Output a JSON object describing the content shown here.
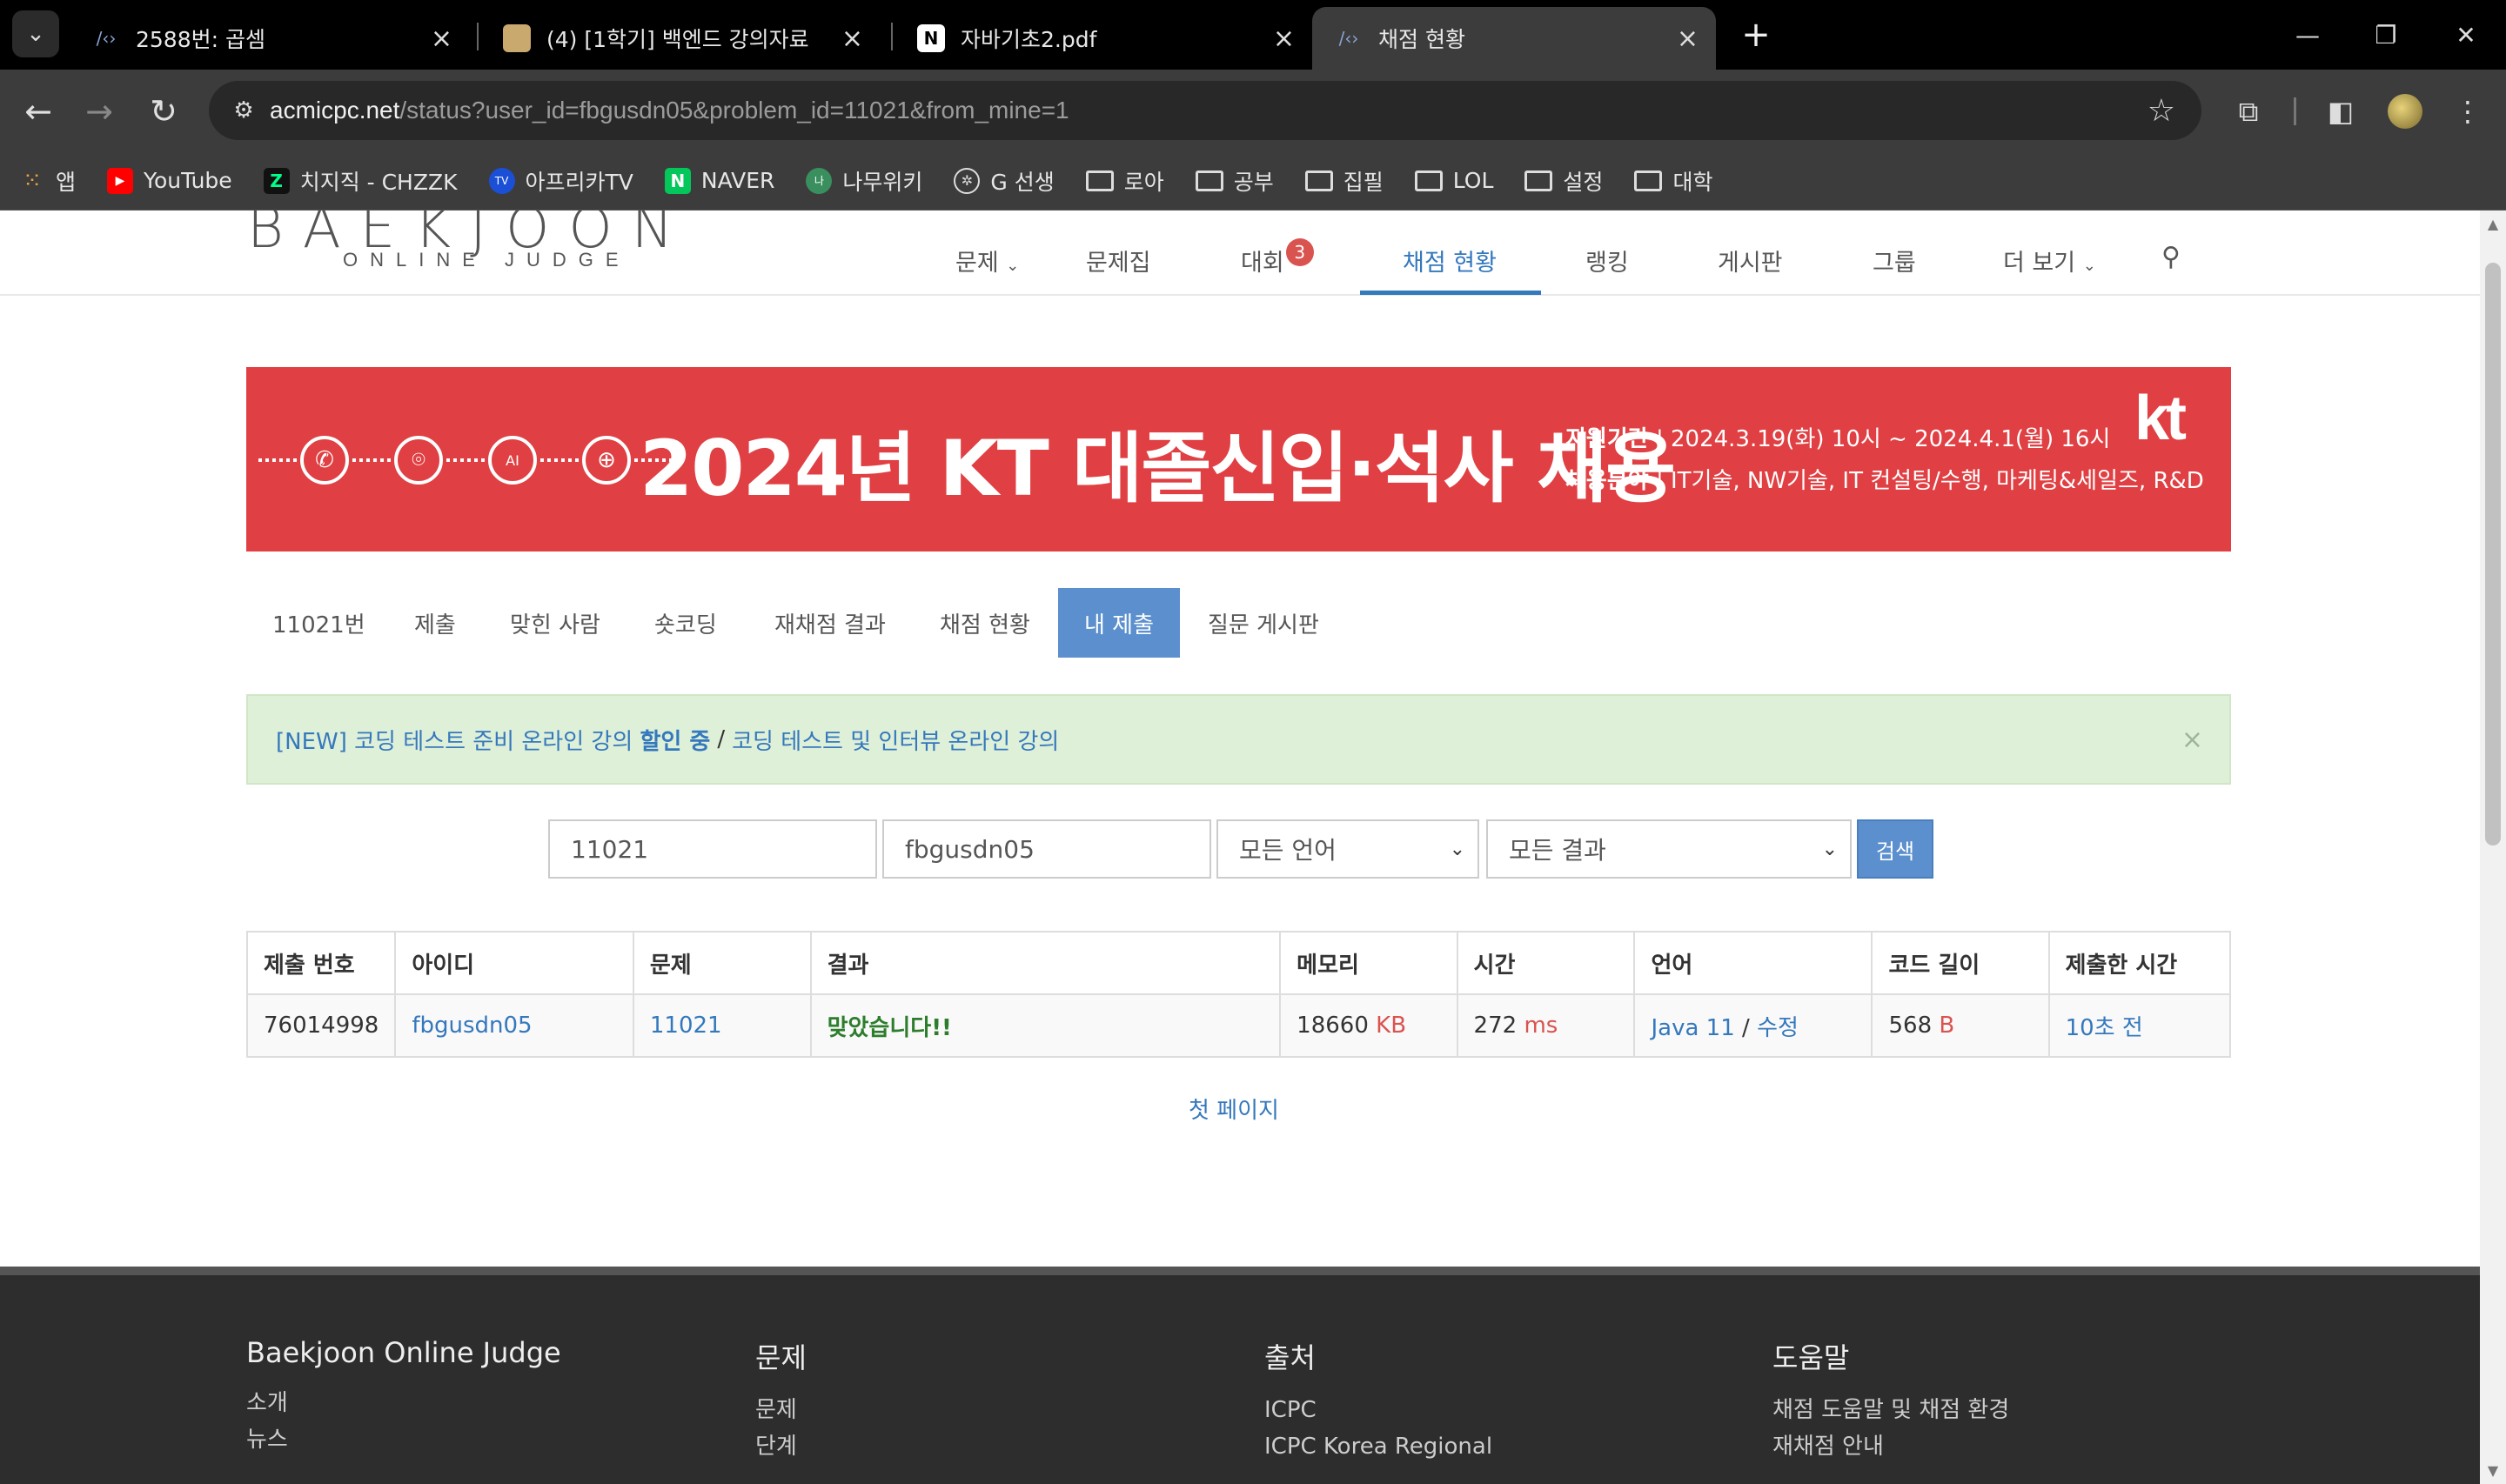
{
  "browser": {
    "tabs": [
      {
        "title": "2588번: 곱셈",
        "favicon": "code-icon"
      },
      {
        "title": "(4) [1학기] 백엔드 강의자료",
        "favicon": "notion-book-icon"
      },
      {
        "title": "자바기초2.pdf",
        "favicon": "notion-icon"
      },
      {
        "title": "채점 현황",
        "favicon": "code-icon"
      }
    ],
    "url_host": "acmicpc.net",
    "url_path": "/status?user_id=fbgusdn05&problem_id=11021&from_mine=1",
    "bookmarks": [
      {
        "label": "앱",
        "icon": "apps-grid-icon"
      },
      {
        "label": "YouTube",
        "icon": "youtube-icon"
      },
      {
        "label": "치지직 - CHZZK",
        "icon": "chzzk-icon"
      },
      {
        "label": "아프리카TV",
        "icon": "afreecatv-icon"
      },
      {
        "label": "NAVER",
        "icon": "naver-icon"
      },
      {
        "label": "나무위키",
        "icon": "namuwiki-icon"
      },
      {
        "label": "G 선생",
        "icon": "chatgpt-icon"
      },
      {
        "label": "로아",
        "icon": "folder-icon"
      },
      {
        "label": "공부",
        "icon": "folder-icon"
      },
      {
        "label": "집필",
        "icon": "folder-icon"
      },
      {
        "label": "LOL",
        "icon": "folder-icon"
      },
      {
        "label": "설정",
        "icon": "folder-icon"
      },
      {
        "label": "대학",
        "icon": "folder-icon"
      }
    ]
  },
  "site": {
    "logo": "BAEKJOON",
    "logo_sub": "ONLINE JUDGE",
    "nav": {
      "problems": "문제",
      "workbook": "문제집",
      "contest": "대회",
      "contest_badge": "3",
      "status": "채점 현황",
      "ranking": "랭킹",
      "board": "게시판",
      "group": "그룹",
      "more": "더 보기"
    }
  },
  "banner": {
    "headline": "2024년 KT 대졸신입·석사 채용",
    "period_label": "지원기간",
    "period_value": "2024.3.19(화) 10시 ~ 2024.4.1(월) 16시",
    "field_label": "채용분야",
    "field_value": "IT기술, NW기술, IT 컨설팅/수행, 마케팅&세일즈, R&D",
    "logo": "kt"
  },
  "problem_tabs": {
    "number": "11021번",
    "submit": "제출",
    "solved_users": "맞힌 사람",
    "short_coding": "숏코딩",
    "rejudge": "재채점 결과",
    "status": "채점 현황",
    "my_submissions": "내 제출",
    "qna": "질문 게시판"
  },
  "alert": {
    "link1_prefix": "[NEW] 코딩 테스트 준비 온라인 강의 ",
    "link1_bold": "할인 중",
    "separator": "/",
    "link2": "코딩 테스트 및 인터뷰 온라인 강의",
    "close": "×"
  },
  "search": {
    "problem_id": "11021",
    "user_id": "fbgusdn05",
    "language": "모든 언어",
    "result": "모든 결과",
    "button": "검색"
  },
  "table": {
    "headers": [
      "제출 번호",
      "아이디",
      "문제",
      "결과",
      "메모리",
      "시간",
      "언어",
      "코드 길이",
      "제출한 시간"
    ],
    "row": {
      "submission_id": "76014998",
      "user": "fbgusdn05",
      "problem": "11021",
      "result": "맞았습니다!!",
      "memory": "18660",
      "memory_unit": "KB",
      "time": "272",
      "time_unit": "ms",
      "language": "Java 11",
      "lang_sep": "/",
      "edit": "수정",
      "code_length": "568",
      "code_unit": "B",
      "submitted": "10초 전"
    }
  },
  "pagination": {
    "first": "첫 페이지"
  },
  "footer": {
    "col1": {
      "title": "Baekjoon Online Judge",
      "items": [
        "소개",
        "뉴스"
      ]
    },
    "col2": {
      "title": "문제",
      "items": [
        "문제",
        "단계"
      ]
    },
    "col3": {
      "title": "출처",
      "items": [
        "ICPC",
        "ICPC Korea Regional"
      ]
    },
    "col4": {
      "title": "도움말",
      "items": [
        "채점 도움말 및 채점 환경",
        "재채점 안내"
      ]
    }
  },
  "colors": {
    "accent": "#3478bd",
    "active_tab": "#5b8fce",
    "banner": "#e04043",
    "correct": "#2d7d2d",
    "unit": "#d9534f"
  }
}
